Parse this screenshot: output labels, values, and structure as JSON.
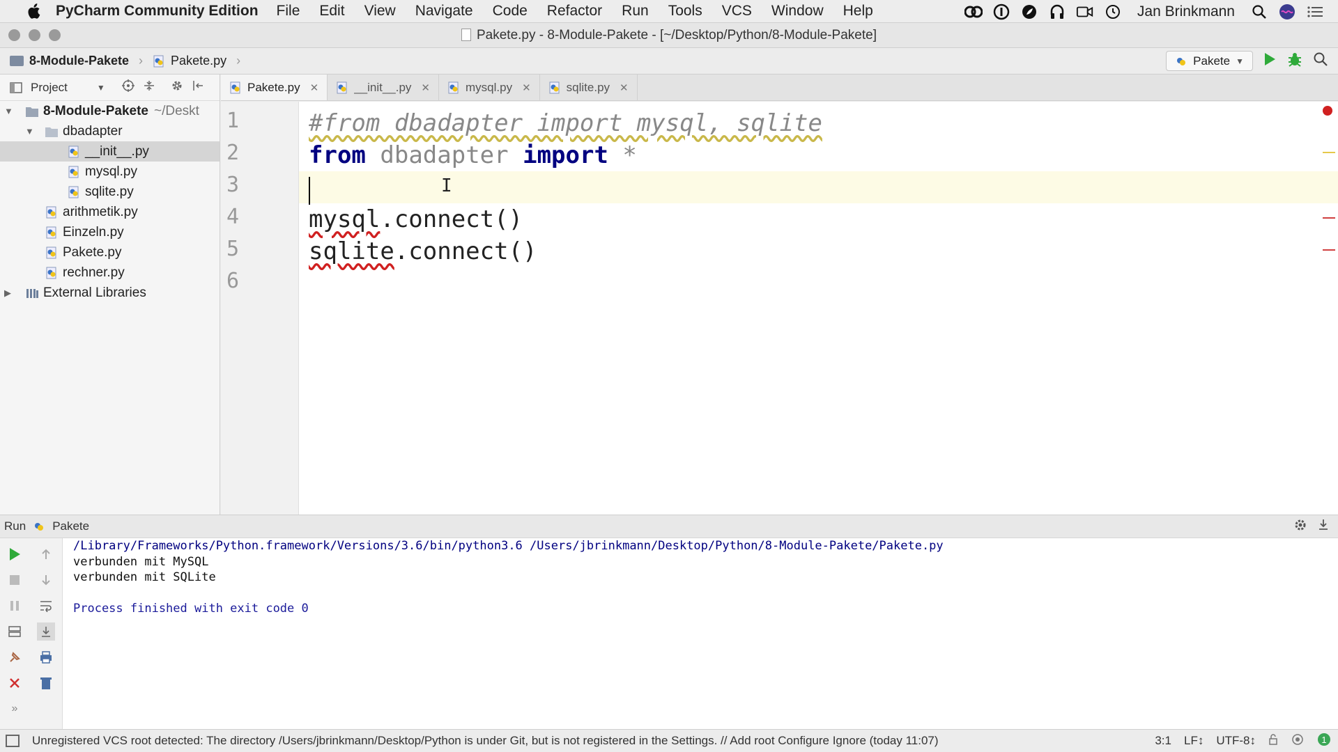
{
  "menubar": {
    "app_name": "PyCharm Community Edition",
    "items": [
      "File",
      "Edit",
      "View",
      "Navigate",
      "Code",
      "Refactor",
      "Run",
      "Tools",
      "VCS",
      "Window",
      "Help"
    ],
    "user": "Jan Brinkmann"
  },
  "window": {
    "title": "Pakete.py - 8-Module-Pakete - [~/Desktop/Python/8-Module-Pakete]"
  },
  "navbar": {
    "project_crumb": "8-Module-Pakete",
    "file_crumb": "Pakete.py",
    "run_config": "Pakete"
  },
  "project_panel": {
    "header": "Project",
    "root": "8-Module-Pakete",
    "root_path": "~/Deskt",
    "folder": "dbadapter",
    "folder_files": [
      "__init__.py",
      "mysql.py",
      "sqlite.py"
    ],
    "files": [
      "arithmetik.py",
      "Einzeln.py",
      "Pakete.py",
      "rechner.py"
    ],
    "external": "External Libraries"
  },
  "tabs": [
    "Pakete.py",
    "__init__.py",
    "mysql.py",
    "sqlite.py"
  ],
  "editor": {
    "line_numbers": [
      "1",
      "2",
      "3",
      "4",
      "5",
      "6"
    ],
    "line1": "#from dbadapter import mysql, sqlite",
    "line2_kw1": "from",
    "line2_mod": "dbadapter",
    "line2_kw2": "import",
    "line2_star": "*",
    "line4_obj": "mysql",
    "line4_call": ".connect()",
    "line5_obj": "sqlite",
    "line5_call": ".connect()"
  },
  "run": {
    "label": "Run",
    "config": "Pakete",
    "command": "/Library/Frameworks/Python.framework/Versions/3.6/bin/python3.6 /Users/jbrinkmann/Desktop/Python/8-Module-Pakete/Pakete.py",
    "output": [
      "verbunden mit MySQL",
      "verbunden mit SQLite"
    ],
    "finish": "Process finished with exit code 0"
  },
  "status": {
    "message": "Unregistered VCS root detected: The directory /Users/jbrinkmann/Desktop/Python is under Git, but is not registered in the Settings. // Add root  Configure  Ignore (today 11:07)",
    "position": "3:1",
    "line_sep": "LF↕",
    "encoding": "UTF-8↕"
  },
  "colors": {
    "keyword": "#000080",
    "error_underline": "#d02020",
    "run_green": "#2faa3a",
    "current_line": "#fdfbe5"
  }
}
